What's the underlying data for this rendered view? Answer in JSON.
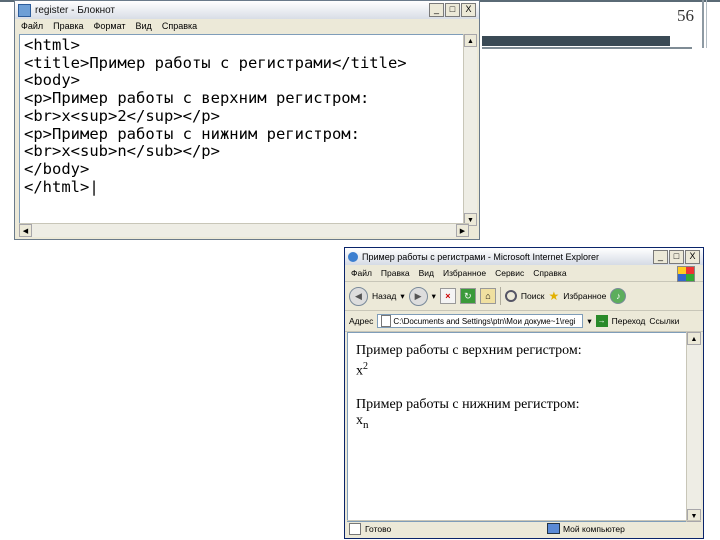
{
  "slide": {
    "number": "56"
  },
  "notepad": {
    "title": "register - Блокнот",
    "window_buttons": [
      "_",
      "□",
      "X"
    ],
    "menu": [
      "Файл",
      "Правка",
      "Формат",
      "Вид",
      "Справка"
    ],
    "code_lines": [
      "<html>",
      "<title>Пример работы с регистрами</title>",
      "<body>",
      "<p>Пример работы с верхним регистром:",
      "<br>x<sup>2</sup></p>",
      "<p>Пример работы с нижним регистром:",
      "<br>x<sub>n</sub></p>",
      "</body>",
      "</html>|"
    ]
  },
  "browser": {
    "title": "Пример работы с регистрами - Microsoft Internet Explorer",
    "window_buttons": [
      "_",
      "□",
      "X"
    ],
    "menu": [
      "Файл",
      "Правка",
      "Вид",
      "Избранное",
      "Сервис",
      "Справка"
    ],
    "toolbar": {
      "back_label": "Назад",
      "search_label": "Поиск",
      "favorites_label": "Избранное"
    },
    "address": {
      "label": "Адрес",
      "value": "C:\\Documents and Settings\\ptn\\Мои докуме~1\\regi",
      "go_label": "Переход",
      "links_label": "Ссылки"
    },
    "content": {
      "para1": "Пример работы с верхним регистром:",
      "base1": "x",
      "sup": "2",
      "para2": "Пример работы с нижним регистром:",
      "base2": "x",
      "sub": "n"
    },
    "status": {
      "text": "Готово",
      "zone": "Мой компьютер"
    }
  }
}
